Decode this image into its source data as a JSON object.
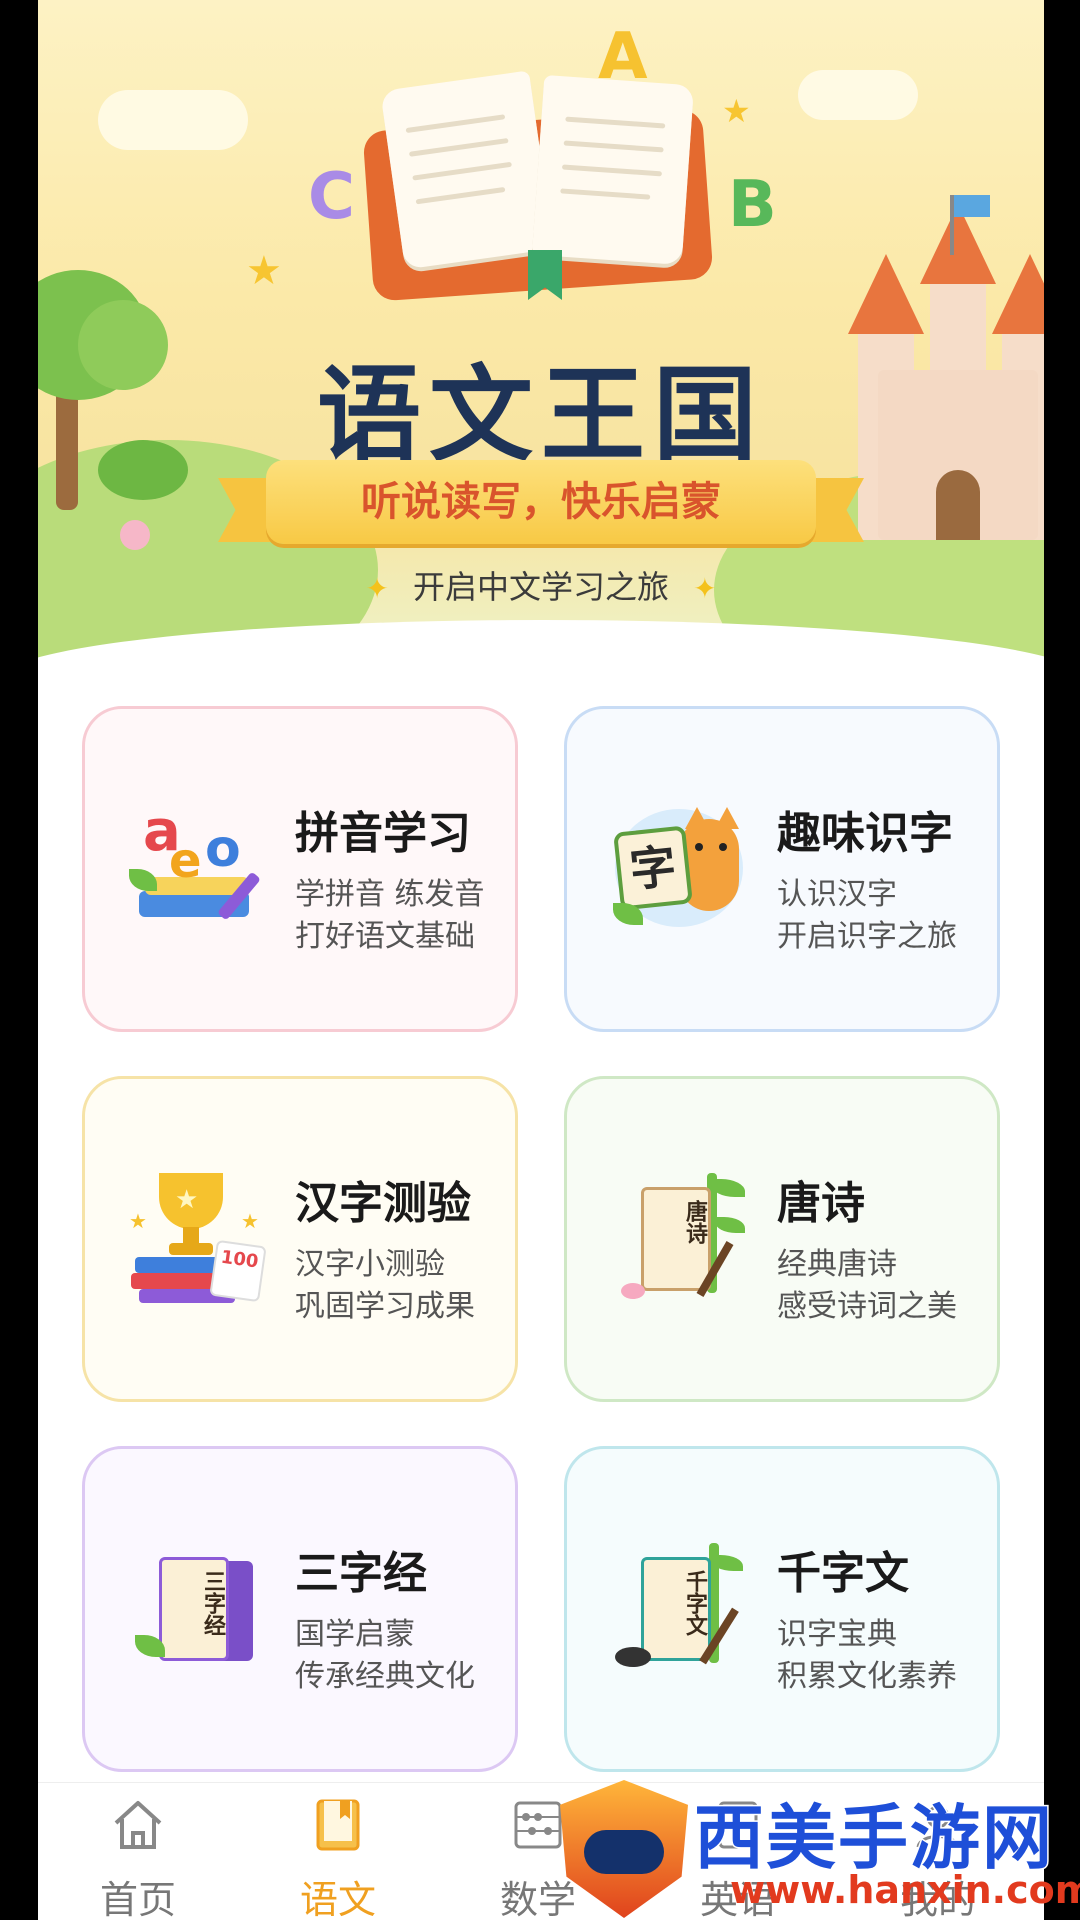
{
  "banner": {
    "title": "语文王国",
    "slogan": "听说读写，快乐启蒙",
    "subtitle": "开启中文学习之旅",
    "letters": [
      "A",
      "B",
      "C"
    ]
  },
  "cards": [
    {
      "title": "拼音学习",
      "line1": "学拼音 练发音",
      "line2": "打好语文基础",
      "icon": "pinyin-letters-icon",
      "icon_text": "aeo"
    },
    {
      "title": "趣味识字",
      "line1": "认识汉字",
      "line2": "开启识字之旅",
      "icon": "cat-character-card-icon",
      "icon_text": "字"
    },
    {
      "title": "汉字测验",
      "line1": "汉字小测验",
      "line2": "巩固学习成果",
      "icon": "trophy-books-icon",
      "icon_text": "100"
    },
    {
      "title": "唐诗",
      "line1": "经典唐诗",
      "line2": "感受诗词之美",
      "icon": "tang-poem-scroll-icon",
      "icon_text": "唐诗"
    },
    {
      "title": "三字经",
      "line1": "国学启蒙",
      "line2": "传承经典文化",
      "icon": "three-character-scroll-icon",
      "icon_text": "三字经"
    },
    {
      "title": "千字文",
      "line1": "识字宝典",
      "line2": "积累文化素养",
      "icon": "thousand-character-scroll-icon",
      "icon_text": "千字文"
    }
  ],
  "nav": [
    {
      "label": "首页",
      "icon": "home-icon"
    },
    {
      "label": "语文",
      "icon": "book-bookmark-icon",
      "active": true
    },
    {
      "label": "数学",
      "icon": "abacus-icon"
    },
    {
      "label": "英语",
      "icon": "english-book-icon"
    },
    {
      "label": "我的",
      "icon": "profile-icon"
    }
  ],
  "watermark": {
    "name": "西美手游网",
    "url": "www.hanxin.com"
  },
  "colors": {
    "accent": "#f0a020",
    "title": "#1e3357",
    "slogan": "#d9542c"
  }
}
